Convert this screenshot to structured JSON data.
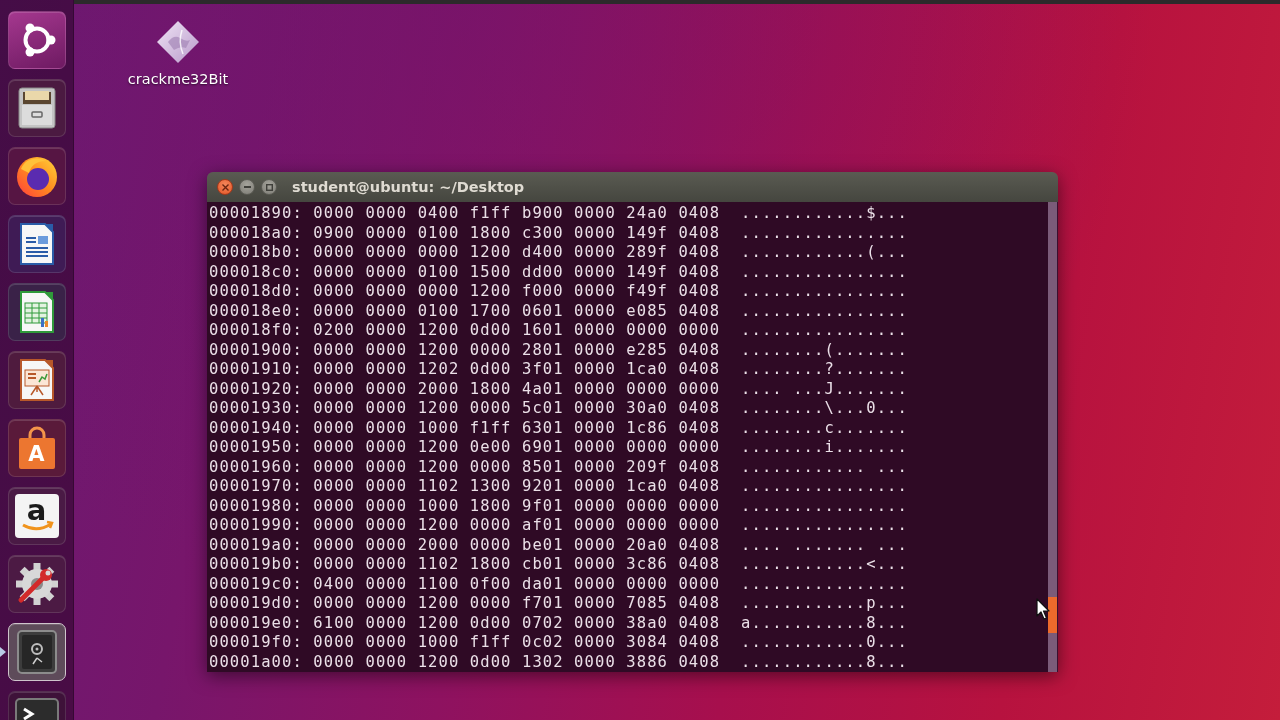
{
  "launcher": {
    "items": [
      {
        "kind": "ubuntu",
        "active": false
      },
      {
        "kind": "files",
        "active": false
      },
      {
        "kind": "browser",
        "active": false
      },
      {
        "kind": "writer",
        "active": false
      },
      {
        "kind": "calc",
        "active": false
      },
      {
        "kind": "impress",
        "active": false
      },
      {
        "kind": "store",
        "glyph": "A",
        "active": false
      },
      {
        "kind": "amazon",
        "glyph": "a",
        "active": false
      },
      {
        "kind": "settings",
        "active": false
      },
      {
        "kind": "safe",
        "active": true
      },
      {
        "kind": "terminal",
        "active": false
      }
    ]
  },
  "desktop": {
    "icons": [
      {
        "label": "crackme32Bit"
      }
    ]
  },
  "terminal": {
    "title": "student@ubuntu: ~/Desktop",
    "rows": [
      {
        "offset": "00001890:",
        "hex": "0000 0000 0400 f1ff b900 0000 24a0 0408",
        "ascii": "............$..."
      },
      {
        "offset": "000018a0:",
        "hex": "0900 0000 0100 1800 c300 0000 149f 0408",
        "ascii": "................"
      },
      {
        "offset": "000018b0:",
        "hex": "0000 0000 0000 1200 d400 0000 289f 0408",
        "ascii": "............(..."
      },
      {
        "offset": "000018c0:",
        "hex": "0000 0000 0100 1500 dd00 0000 149f 0408",
        "ascii": "................"
      },
      {
        "offset": "000018d0:",
        "hex": "0000 0000 0000 1200 f000 0000 f49f 0408",
        "ascii": "................"
      },
      {
        "offset": "000018e0:",
        "hex": "0000 0000 0100 1700 0601 0000 e085 0408",
        "ascii": "................"
      },
      {
        "offset": "000018f0:",
        "hex": "0200 0000 1200 0d00 1601 0000 0000 0000",
        "ascii": "................"
      },
      {
        "offset": "00001900:",
        "hex": "0000 0000 1200 0000 2801 0000 e285 0408",
        "ascii": "........(......."
      },
      {
        "offset": "00001910:",
        "hex": "0000 0000 1202 0d00 3f01 0000 1ca0 0408",
        "ascii": "........?......."
      },
      {
        "offset": "00001920:",
        "hex": "0000 0000 2000 1800 4a01 0000 0000 0000",
        "ascii": ".... ...J......."
      },
      {
        "offset": "00001930:",
        "hex": "0000 0000 1200 0000 5c01 0000 30a0 0408",
        "ascii": "........\\...0..."
      },
      {
        "offset": "00001940:",
        "hex": "0000 0000 1000 f1ff 6301 0000 1c86 0408",
        "ascii": "........c......."
      },
      {
        "offset": "00001950:",
        "hex": "0000 0000 1200 0e00 6901 0000 0000 0000",
        "ascii": "........i......."
      },
      {
        "offset": "00001960:",
        "hex": "0000 0000 1200 0000 8501 0000 209f 0408",
        "ascii": "............ ..."
      },
      {
        "offset": "00001970:",
        "hex": "0000 0000 1102 1300 9201 0000 1ca0 0408",
        "ascii": "................"
      },
      {
        "offset": "00001980:",
        "hex": "0000 0000 1000 1800 9f01 0000 0000 0000",
        "ascii": "................"
      },
      {
        "offset": "00001990:",
        "hex": "0000 0000 1200 0000 af01 0000 0000 0000",
        "ascii": "................"
      },
      {
        "offset": "000019a0:",
        "hex": "0000 0000 2000 0000 be01 0000 20a0 0408",
        "ascii": ".... ....... ..."
      },
      {
        "offset": "000019b0:",
        "hex": "0000 0000 1102 1800 cb01 0000 3c86 0408",
        "ascii": "............<..."
      },
      {
        "offset": "000019c0:",
        "hex": "0400 0000 1100 0f00 da01 0000 0000 0000",
        "ascii": "................"
      },
      {
        "offset": "000019d0:",
        "hex": "0000 0000 1200 0000 f701 0000 7085 0408",
        "ascii": "............p..."
      },
      {
        "offset": "000019e0:",
        "hex": "6100 0000 1200 0d00 0702 0000 38a0 0408",
        "ascii": "a...........8..."
      },
      {
        "offset": "000019f0:",
        "hex": "0000 0000 1000 f1ff 0c02 0000 3084 0408",
        "ascii": "............0..."
      },
      {
        "offset": "00001a00:",
        "hex": "0000 0000 1200 0d00 1302 0000 3886 0408",
        "ascii": "............8..."
      }
    ]
  }
}
